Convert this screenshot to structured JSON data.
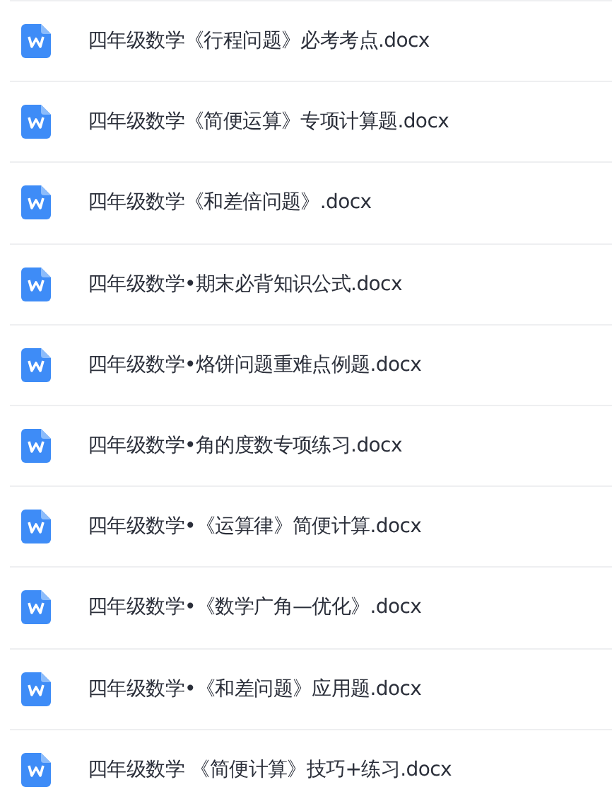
{
  "files": [
    {
      "name": "四年级数学《行程问题》必考考点.docx"
    },
    {
      "name": "四年级数学《简便运算》专项计算题.docx"
    },
    {
      "name": "四年级数学《和差倍问题》.docx"
    },
    {
      "name": "四年级数学•期末必背知识公式.docx"
    },
    {
      "name": "四年级数学•烙饼问题重难点例题.docx"
    },
    {
      "name": "四年级数学•角的度数专项练习.docx"
    },
    {
      "name": "四年级数学•《运算律》简便计算.docx"
    },
    {
      "name": "四年级数学•《数学广角—优化》.docx"
    },
    {
      "name": "四年级数学•《和差问题》应用题.docx"
    },
    {
      "name": "四年级数学 《简便计算》技巧+练习.docx"
    }
  ]
}
